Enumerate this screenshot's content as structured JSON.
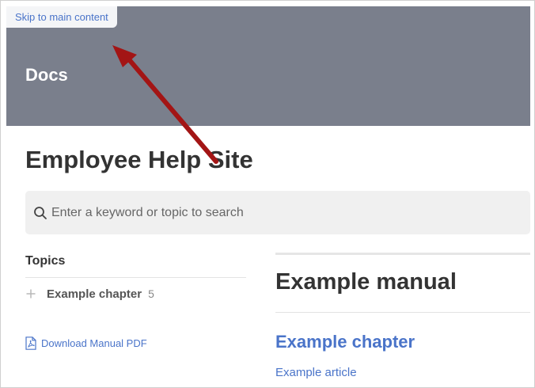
{
  "skip_link": {
    "label": "Skip to main content"
  },
  "header": {
    "brand": "Docs",
    "background_color": "#7a7f8c"
  },
  "page": {
    "title": "Employee Help Site"
  },
  "search": {
    "placeholder": "Enter a keyword or topic to search",
    "value": "",
    "icon": "search-icon"
  },
  "sidebar": {
    "heading": "Topics",
    "topics": [
      {
        "label": "Example chapter",
        "count": "5",
        "icon": "plus-icon"
      }
    ],
    "download": {
      "label": "Download Manual PDF",
      "icon": "pdf-icon"
    }
  },
  "main": {
    "manual_title": "Example manual",
    "chapter_title": "Example chapter",
    "article_title": "Example article"
  },
  "annotation": {
    "type": "arrow",
    "color": "#a31515"
  },
  "colors": {
    "accent_link": "#4a74c9",
    "text_dark": "#333333",
    "search_background": "#f0f0f0"
  }
}
